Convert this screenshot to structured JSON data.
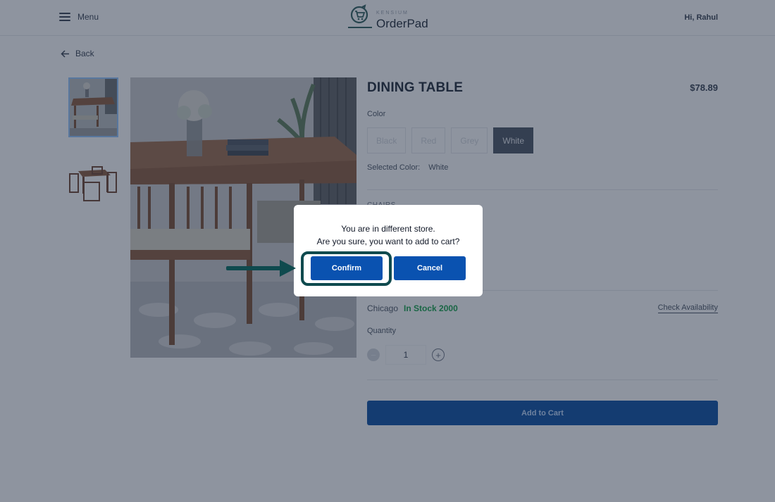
{
  "header": {
    "menu_label": "Menu",
    "logo_kensium": "KENSIUM",
    "logo_name": "OrderPad",
    "greeting": "Hi, Rahul"
  },
  "nav": {
    "back_label": "Back"
  },
  "product": {
    "title": "DINING TABLE",
    "price": "$78.89",
    "color_label": "Color",
    "colors": [
      "Black",
      "Red",
      "Grey",
      "White"
    ],
    "selected_color_label": "Selected Color:",
    "selected_color": "White",
    "chairs_label": "CHAIRS",
    "store": "Chicago",
    "stock_status": "In Stock 2000",
    "check_availability": "Check Availability",
    "quantity_label": "Quantity",
    "quantity": "1",
    "add_to_cart": "Add to Cart"
  },
  "modal": {
    "line1": "You are in different store.",
    "line2": "Are you sure, you want to add to cart?",
    "confirm": "Confirm",
    "cancel": "Cancel"
  },
  "colors": {
    "primary": "#0a52b0",
    "highlight": "#0f4a4e",
    "in_stock": "#16a34a"
  }
}
